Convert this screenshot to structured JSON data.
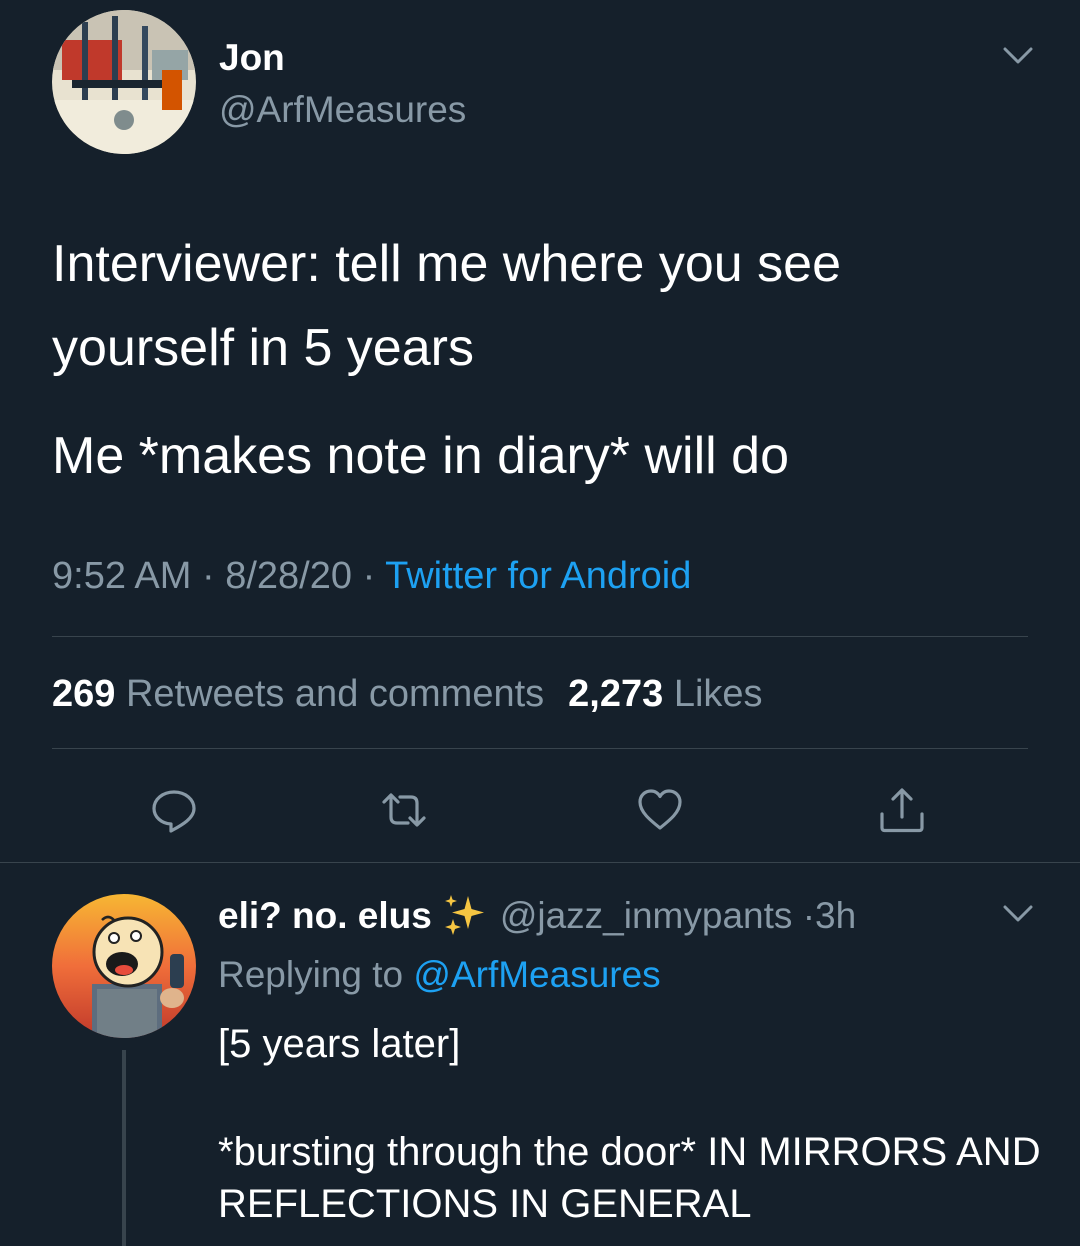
{
  "tweet": {
    "author_name": "Jon",
    "author_handle": "@ArfMeasures",
    "text_lines": [
      "Interviewer: tell me where you see yourself in 5 years",
      "Me *makes note in diary* will do"
    ],
    "time": "9:52 AM",
    "date": "8/28/20",
    "separator": "·",
    "source": "Twitter for Android",
    "retweets_count": "269",
    "retweets_label": "Retweets and comments",
    "likes_count": "2,273",
    "likes_label": "Likes",
    "icons": [
      "reply-icon",
      "retweet-icon",
      "like-icon",
      "share-icon",
      "chevron-down-icon"
    ]
  },
  "reply": {
    "author_name": "eli? no. elus",
    "emoji": "sparkles-icon",
    "author_handle": "@jazz_inmypants",
    "separator": "·",
    "age": "3h",
    "replying_prefix": "Replying to",
    "replying_to": "@ArfMeasures",
    "text_lines": [
      "[5 years later]",
      "*bursting through the door* IN MIRRORS AND REFLECTIONS IN GENERAL"
    ]
  },
  "colors": {
    "background": "#15202b",
    "text": "#ffffff",
    "secondary": "#8899a6",
    "accent": "#1da1f2",
    "divider": "#38444d"
  }
}
